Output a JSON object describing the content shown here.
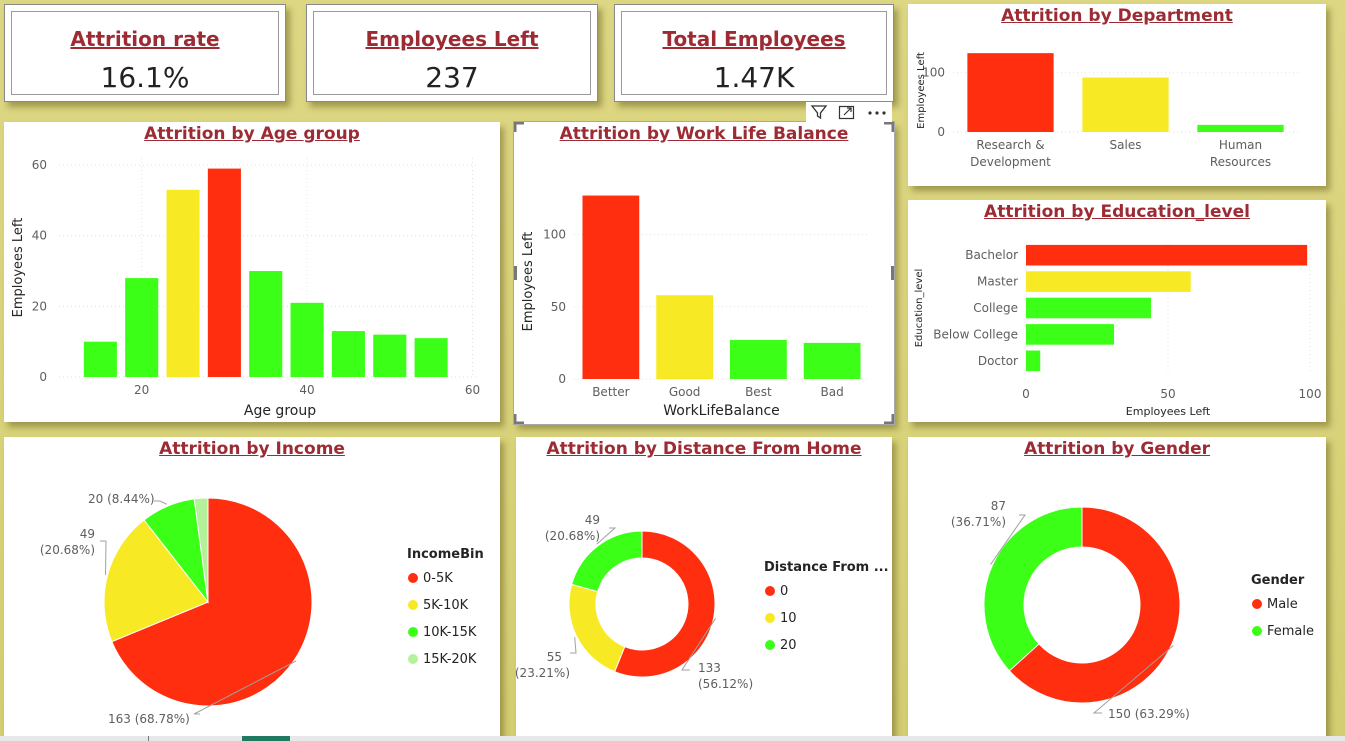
{
  "kpis": [
    {
      "label": "Attrition rate",
      "value": "16.1%"
    },
    {
      "label": "Employees Left",
      "value": "237"
    },
    {
      "label": "Total Employees",
      "value": "1.47K"
    }
  ],
  "colors": {
    "red": "#ff2e0f",
    "yellow": "#f7ea24",
    "green": "#3cff17",
    "lightgreen": "#b3f29a",
    "title": "#9d2b34"
  },
  "toolbar": {
    "filter_icon": "filter-icon",
    "focus_icon": "focus-mode-icon",
    "more_icon": "more-options-icon"
  },
  "chart_data": [
    {
      "id": "department",
      "type": "bar",
      "title": "Attrition by Department",
      "ylabel": "Employees Left",
      "xlabel": "",
      "categories": [
        "Research & Development",
        "Sales",
        "Human Resources"
      ],
      "category_lines": [
        [
          "Research &",
          "Development"
        ],
        [
          "Sales"
        ],
        [
          "Human",
          "Resources"
        ]
      ],
      "values": [
        133,
        92,
        12
      ],
      "colors": [
        "#ff2e0f",
        "#f7ea24",
        "#3cff17"
      ],
      "yticks": [
        0,
        100
      ],
      "ylim": [
        0,
        140
      ]
    },
    {
      "id": "age",
      "type": "bar",
      "title": "Attrition by Age group",
      "ylabel": "Employees Left",
      "xlabel": "Age group",
      "x": [
        15,
        20,
        25,
        30,
        35,
        40,
        45,
        50,
        55
      ],
      "values": [
        10,
        28,
        53,
        59,
        30,
        21,
        13,
        12,
        11
      ],
      "colors": [
        "#3cff17",
        "#3cff17",
        "#f7ea24",
        "#ff2e0f",
        "#3cff17",
        "#3cff17",
        "#3cff17",
        "#3cff17",
        "#3cff17"
      ],
      "xticks": [
        20,
        40,
        60
      ],
      "xlim": [
        10,
        62
      ],
      "yticks": [
        0,
        20,
        40,
        60
      ],
      "ylim": [
        0,
        62
      ]
    },
    {
      "id": "wlb",
      "type": "bar",
      "title": "Attrition by Work Life Balance",
      "ylabel": "Employees Left",
      "xlabel": "WorkLifeBalance",
      "categories": [
        "Better",
        "Good",
        "Best",
        "Bad"
      ],
      "values": [
        127,
        58,
        27,
        25
      ],
      "colors": [
        "#ff2e0f",
        "#f7ea24",
        "#3cff17",
        "#3cff17"
      ],
      "yticks": [
        0,
        50,
        100
      ],
      "ylim": [
        0,
        135
      ]
    },
    {
      "id": "education",
      "type": "bar",
      "orientation": "horizontal",
      "title": "Attrition by Education_level",
      "ylabel": "Education_level",
      "xlabel": "Employees Left",
      "categories": [
        "Bachelor",
        "Master",
        "College",
        "Below College",
        "Doctor"
      ],
      "values": [
        99,
        58,
        44,
        31,
        5
      ],
      "colors": [
        "#ff2e0f",
        "#f7ea24",
        "#3cff17",
        "#3cff17",
        "#3cff17"
      ],
      "xticks": [
        0,
        50,
        100
      ],
      "xlim": [
        0,
        100
      ]
    },
    {
      "id": "income",
      "type": "pie",
      "title": "Attrition by Income",
      "legend_title": "IncomeBin",
      "labels": [
        "0-5K",
        "5K-10K",
        "10K-15K",
        "15K-20K"
      ],
      "values": [
        163,
        49,
        20,
        5
      ],
      "colors": [
        "#ff2e0f",
        "#f7ea24",
        "#3cff17",
        "#b3f29a"
      ],
      "data_labels": [
        "163 (68.78%)",
        "49 (20.68%)",
        "20 (8.44%)",
        ""
      ],
      "legend": "right"
    },
    {
      "id": "distance",
      "type": "pie",
      "donut": true,
      "title": "Attrition by Distance From Home",
      "legend_title": "Distance From ...",
      "labels": [
        "0",
        "10",
        "20"
      ],
      "values": [
        133,
        55,
        49
      ],
      "colors": [
        "#ff2e0f",
        "#f7ea24",
        "#3cff17"
      ],
      "data_labels": [
        "133 (56.12%)",
        "55 (23.21%)",
        "49 (20.68%)"
      ],
      "legend": "right"
    },
    {
      "id": "gender",
      "type": "pie",
      "donut": true,
      "title": "Attrition by Gender",
      "legend_title": "Gender",
      "labels": [
        "Male",
        "Female"
      ],
      "values": [
        150,
        87
      ],
      "colors": [
        "#ff2e0f",
        "#3cff17"
      ],
      "data_labels": [
        "150 (63.29%)",
        "87 (36.71%)"
      ],
      "legend": "right"
    }
  ]
}
